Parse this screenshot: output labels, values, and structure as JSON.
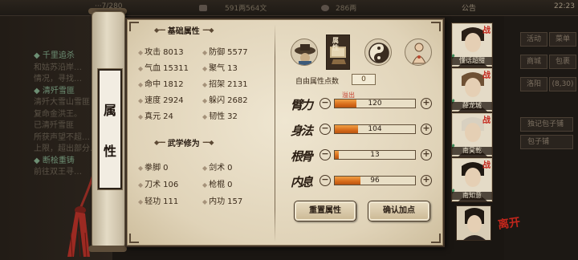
{
  "hud": {
    "top_left": "···7/280",
    "money": "591两564文",
    "silver": "286两",
    "notice": "公告",
    "time": "22:23"
  },
  "quest_log": [
    {
      "text": "◆ 千里追杀",
      "dim": false
    },
    {
      "text": "和姑苏沿岸…",
      "dim": true
    },
    {
      "text": "情况，寻找…",
      "dim": true
    },
    {
      "text": "◆ 清歼雪匪",
      "dim": false
    },
    {
      "text": "清歼大雪山雪匪",
      "dim": true
    },
    {
      "text": "复命金洪王。",
      "dim": true
    },
    {
      "text": "已清歼雪匪",
      "dim": true
    },
    {
      "text": "所获声望不超…",
      "dim": true
    },
    {
      "text": "上限，超出部分…",
      "dim": true
    },
    {
      "text": "◆ 断桧重铸",
      "dim": false
    },
    {
      "text": "前往双王寻…",
      "dim": true
    }
  ],
  "right_menu": {
    "buttons": [
      "活动",
      "菜单",
      "商城",
      "包裹",
      "洛阳",
      "(8,30)"
    ],
    "pills": [
      "独记包子铺",
      "包子铺"
    ]
  },
  "tag_text": [
    "属",
    "性"
  ],
  "basic": {
    "title": "基础属性",
    "stats": [
      {
        "label": "攻击",
        "value": "8013"
      },
      {
        "label": "防御",
        "value": "5577"
      },
      {
        "label": "气血",
        "value": "15311"
      },
      {
        "label": "聚气",
        "value": "13"
      },
      {
        "label": "命中",
        "value": "1812"
      },
      {
        "label": "招架",
        "value": "2131"
      },
      {
        "label": "速度",
        "value": "2924"
      },
      {
        "label": "躲闪",
        "value": "2682"
      },
      {
        "label": "真元",
        "value": "24"
      },
      {
        "label": "韧性",
        "value": "32"
      }
    ]
  },
  "martial": {
    "title": "武学修为",
    "stats": [
      {
        "label": "拳脚",
        "value": "0"
      },
      {
        "label": "剑术",
        "value": "0"
      },
      {
        "label": "刀术",
        "value": "106"
      },
      {
        "label": "枪棍",
        "value": "0"
      },
      {
        "label": "轻功",
        "value": "111"
      },
      {
        "label": "内功",
        "value": "157"
      }
    ]
  },
  "attr_tab_selected": "属性",
  "free_points": {
    "label": "自由属性点数",
    "value": "0"
  },
  "overflow_label": "溢出",
  "attributes": [
    {
      "glyph": "臂力",
      "value": "120",
      "fill": 0.27
    },
    {
      "glyph": "身法",
      "value": "104",
      "fill": 0.29
    },
    {
      "glyph": "根骨",
      "value": "13",
      "fill": 0.05
    },
    {
      "glyph": "内息",
      "value": "96",
      "fill": 0.32
    }
  ],
  "buttons": {
    "reset": "重置属性",
    "confirm": "确认加点"
  },
  "party": [
    {
      "name": "懂话超甜",
      "fight": "战"
    },
    {
      "name": "薛龙城",
      "fight": "战"
    },
    {
      "name": "南昊乾",
      "fight": "战"
    },
    {
      "name": "南知意",
      "fight": "战"
    }
  ],
  "leave_label": "离开",
  "colors": {
    "bar_fill": "#d76b1a",
    "accent_red": "#c4261c",
    "panel": "#e6dcc5"
  }
}
